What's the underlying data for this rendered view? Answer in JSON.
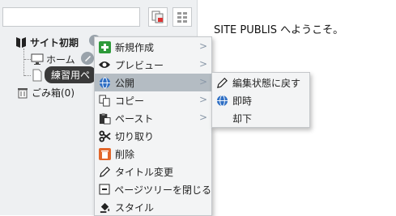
{
  "search": {
    "value": "",
    "placeholder": ""
  },
  "toolbar": {
    "copy_icon": "copy-pages-icon",
    "grid_icon": "grid-icon"
  },
  "tree": {
    "site_label": "サイト初期",
    "home_label": "ホーム",
    "practice_label": "練習用ペ",
    "trash_label": "ごみ箱(0)"
  },
  "welcome_text": "SITE PUBLIS へようこそ。",
  "context_menu": {
    "items": [
      {
        "label": "新規作成",
        "icon": "plus-icon",
        "arrow": ">"
      },
      {
        "label": "プレビュー",
        "icon": "eye-icon",
        "arrow": ">"
      },
      {
        "label": "公開",
        "icon": "globe-icon",
        "arrow": ">"
      },
      {
        "label": "コピー",
        "icon": "copy-icon",
        "arrow": ">"
      },
      {
        "label": "ペースト",
        "icon": "paste-icon",
        "arrow": ">"
      },
      {
        "label": "切り取り",
        "icon": "scissors-icon",
        "arrow": ""
      },
      {
        "label": "削除",
        "icon": "trash-icon",
        "arrow": ""
      },
      {
        "label": "タイトル変更",
        "icon": "pencil-icon",
        "arrow": ""
      },
      {
        "label": "ページツリーを閉じる",
        "icon": "collapse-icon",
        "arrow": ""
      },
      {
        "label": "スタイル",
        "icon": "paint-bucket-icon",
        "arrow": ""
      }
    ]
  },
  "publish_submenu": {
    "items": [
      {
        "label": "編集状態に戻す",
        "icon": "pencil-icon"
      },
      {
        "label": "即時",
        "icon": "globe-icon"
      },
      {
        "label": "却下",
        "icon": ""
      }
    ]
  },
  "colors": {
    "highlight": "#b4bcc3",
    "menu_bg": "#f3f4f5",
    "panel_bg": "#eef0f2",
    "plus_green": "#2e9a3a",
    "trash_orange": "#e2662a",
    "globe_blue": "#2f6fc4"
  }
}
